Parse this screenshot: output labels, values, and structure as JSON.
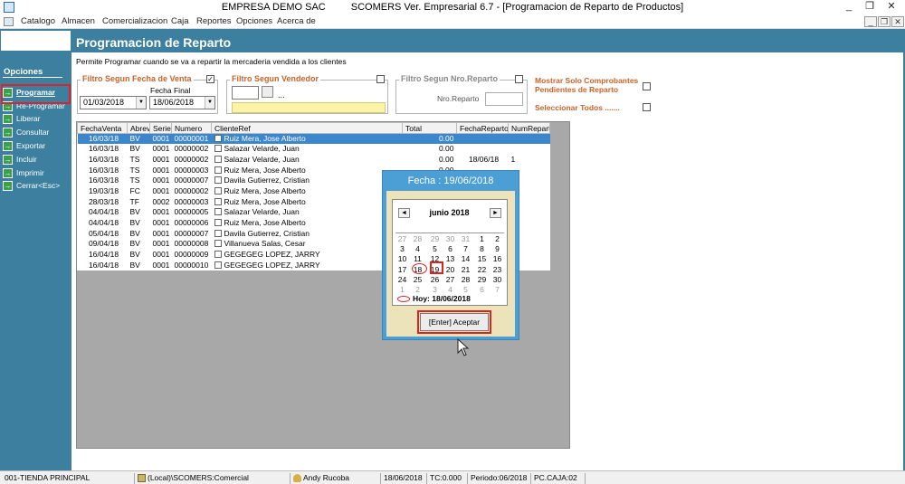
{
  "window": {
    "company": "EMPRESA DEMO SAC",
    "app_title": "SCOMERS Ver. Empresarial  6.7 - [Programacion de Reparto de Productos]",
    "minimize": "_",
    "restore": "❐",
    "close": "✕"
  },
  "menu": [
    "Catalogo",
    "Almacen",
    "Comercializacion",
    "Caja",
    "Reportes",
    "Opciones",
    "Acerca de"
  ],
  "sidebar": {
    "title": "Opciones",
    "items": [
      "Programar",
      "Re-Programar",
      "Liberar",
      "Consultar",
      "Exportar",
      "Incluir",
      "Imprimir",
      "Cerrar<Esc>"
    ]
  },
  "page": {
    "title": "Programacion de Reparto",
    "subtitle": "Permite Programar cuando se va a repartir la mercaderia vendida a los clientes"
  },
  "filters": {
    "fecha": {
      "label": "Filtro Segun Fecha de Venta",
      "checked": "✓",
      "final_label": "Fecha Final",
      "start": "01/03/2018",
      "end": "18/06/2018"
    },
    "vendedor": {
      "label": "Filtro Segun Vendedor",
      "ellipsis": "..."
    },
    "reparto": {
      "label": "Filtro Segun Nro.Reparto",
      "field_label": "Nro.Reparto"
    },
    "pendientes_label": "Mostrar Solo Comprobantes Pendientes de Reparto",
    "todos_label": "Seleccionar Todos ......."
  },
  "table": {
    "columns": [
      "FechaVenta",
      "Abrev",
      "Serie",
      "Numero",
      "ClienteRef",
      "Total",
      "FechaReparto",
      "NumReparto"
    ],
    "rows": [
      [
        "16/03/18",
        "BV",
        "0001",
        "00000001",
        "Ruiz Mera, Jose Alberto",
        "0.00",
        "",
        ""
      ],
      [
        "16/03/18",
        "BV",
        "0001",
        "00000002",
        "Salazar Velarde, Juan",
        "0.00",
        "",
        ""
      ],
      [
        "16/03/18",
        "TS",
        "0001",
        "00000002",
        "Salazar Velarde, Juan",
        "0.00",
        "18/06/18",
        "1"
      ],
      [
        "16/03/18",
        "TS",
        "0001",
        "00000003",
        "Ruiz Mera, Jose Alberto",
        "0.00",
        "",
        ""
      ],
      [
        "16/03/18",
        "TS",
        "0001",
        "00000007",
        "Davila Gutierrez, Cristian",
        "",
        "",
        ""
      ],
      [
        "19/03/18",
        "FC",
        "0001",
        "00000002",
        "Ruiz Mera, Jose Alberto",
        "",
        "",
        ""
      ],
      [
        "28/03/18",
        "TF",
        "0002",
        "00000003",
        "Ruiz Mera, Jose Alberto",
        "",
        "",
        ""
      ],
      [
        "04/04/18",
        "BV",
        "0001",
        "00000005",
        "Salazar Velarde, Juan",
        "",
        "",
        ""
      ],
      [
        "04/04/18",
        "BV",
        "0001",
        "00000006",
        "Ruiz Mera, Jose Alberto",
        "",
        "",
        ""
      ],
      [
        "05/04/18",
        "BV",
        "0001",
        "00000007",
        "Davila Gutierrez, Cristian",
        "",
        "",
        ""
      ],
      [
        "09/04/18",
        "BV",
        "0001",
        "00000008",
        "Villanueva  Salas, Cesar",
        "",
        "",
        ""
      ],
      [
        "16/04/18",
        "BV",
        "0001",
        "00000009",
        "GEGEGEG LOPEZ, JARRY",
        "",
        "",
        ""
      ],
      [
        "16/04/18",
        "BV",
        "0001",
        "00000010",
        "GEGEGEG LOPEZ, JARRY",
        "",
        "",
        ""
      ]
    ]
  },
  "calendar_dialog": {
    "title": "Fecha : 19/06/2018",
    "month_label": "junio 2018",
    "prev": "◄",
    "next": "►",
    "weeks": [
      [
        "27",
        "28",
        "29",
        "30",
        "31",
        "1",
        "2"
      ],
      [
        "3",
        "4",
        "5",
        "6",
        "7",
        "8",
        "9"
      ],
      [
        "10",
        "11",
        "12",
        "13",
        "14",
        "15",
        "16"
      ],
      [
        "17",
        "18",
        "19",
        "20",
        "21",
        "22",
        "23"
      ],
      [
        "24",
        "25",
        "26",
        "27",
        "28",
        "29",
        "30"
      ],
      [
        "1",
        "2",
        "3",
        "4",
        "5",
        "6",
        "7"
      ]
    ],
    "today_label": "Hoy: 18/06/2018",
    "accept_label": "[Enter] Aceptar"
  },
  "status": [
    "001-TIENDA PRINCIPAL",
    "(Local)\\SCOMERS:Comercial",
    "Andy Rucoba",
    "18/06/2018",
    "TC:0.000",
    "Periodo:06/2018",
    "PC.CAJA:02"
  ]
}
